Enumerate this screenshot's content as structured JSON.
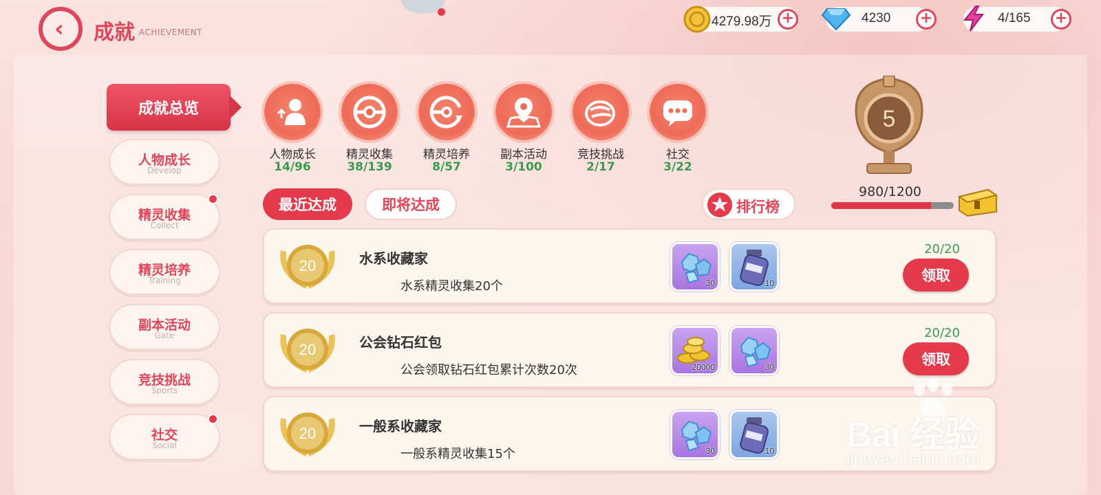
{
  "header": {
    "title": "成就",
    "subtitle": "ACHIEVEMENT"
  },
  "currencies": [
    {
      "name": "gold-coin",
      "value": "4279.98万"
    },
    {
      "name": "diamond",
      "value": "4230"
    },
    {
      "name": "energy",
      "value": "4/165"
    }
  ],
  "sidebar": {
    "active_label": "成就总览",
    "items": [
      {
        "cn": "人物成长",
        "en": "Develop",
        "has_dot": false
      },
      {
        "cn": "精灵收集",
        "en": "Collect",
        "has_dot": true
      },
      {
        "cn": "精灵培养",
        "en": "Training",
        "has_dot": false
      },
      {
        "cn": "副本活动",
        "en": "Gate",
        "has_dot": false
      },
      {
        "cn": "竞技挑战",
        "en": "Sports",
        "has_dot": false
      },
      {
        "cn": "社交",
        "en": "Social",
        "has_dot": true
      }
    ]
  },
  "categories": [
    {
      "label": "人物成长",
      "count": "14/96",
      "icon": "person-growth-icon"
    },
    {
      "label": "精灵收集",
      "count": "38/139",
      "icon": "pokeball-icon"
    },
    {
      "label": "精灵培养",
      "count": "8/57",
      "icon": "pokeball-train-icon"
    },
    {
      "label": "副本活动",
      "count": "3/100",
      "icon": "map-pin-icon"
    },
    {
      "label": "竞技挑战",
      "count": "2/17",
      "icon": "sports-icon"
    },
    {
      "label": "社交",
      "count": "3/22",
      "icon": "chat-bubble-icon"
    }
  ],
  "trophy": {
    "level": "5",
    "progress_text": "980/1200",
    "progress_fraction": 0.8167
  },
  "tabs": {
    "recent": "最近达成",
    "upcoming": "即将达成",
    "leaderboard": "排行榜"
  },
  "achievements": [
    {
      "medal": "20",
      "title": "水系收藏家",
      "desc": "水系精灵收集20个",
      "rewards": [
        {
          "type": "crystal",
          "qty": "30",
          "color": "purple"
        },
        {
          "type": "potion",
          "qty": "10",
          "color": "blue"
        }
      ],
      "progress": "20/20",
      "claim": "领取"
    },
    {
      "medal": "20",
      "title": "公会钻石红包",
      "desc": "公会领取钻石红包累计次数20次",
      "rewards": [
        {
          "type": "gold-coins",
          "qty": "20000",
          "color": "purple"
        },
        {
          "type": "crystal",
          "qty": "30",
          "color": "purple"
        }
      ],
      "progress": "20/20",
      "claim": "领取"
    },
    {
      "medal": "20",
      "title": "一般系收藏家",
      "desc": "一般系精灵收集15个",
      "rewards": [
        {
          "type": "crystal",
          "qty": "30",
          "color": "purple"
        },
        {
          "type": "potion",
          "qty": "10",
          "color": "blue"
        }
      ],
      "progress": "",
      "claim": ""
    }
  ],
  "watermark": {
    "main": "Bai 经验",
    "sub": "jingyan.baidu.com"
  },
  "colors": {
    "accent": "#e43a4b",
    "progress_green": "#3a9a4e",
    "background": "#f8d9d6"
  }
}
